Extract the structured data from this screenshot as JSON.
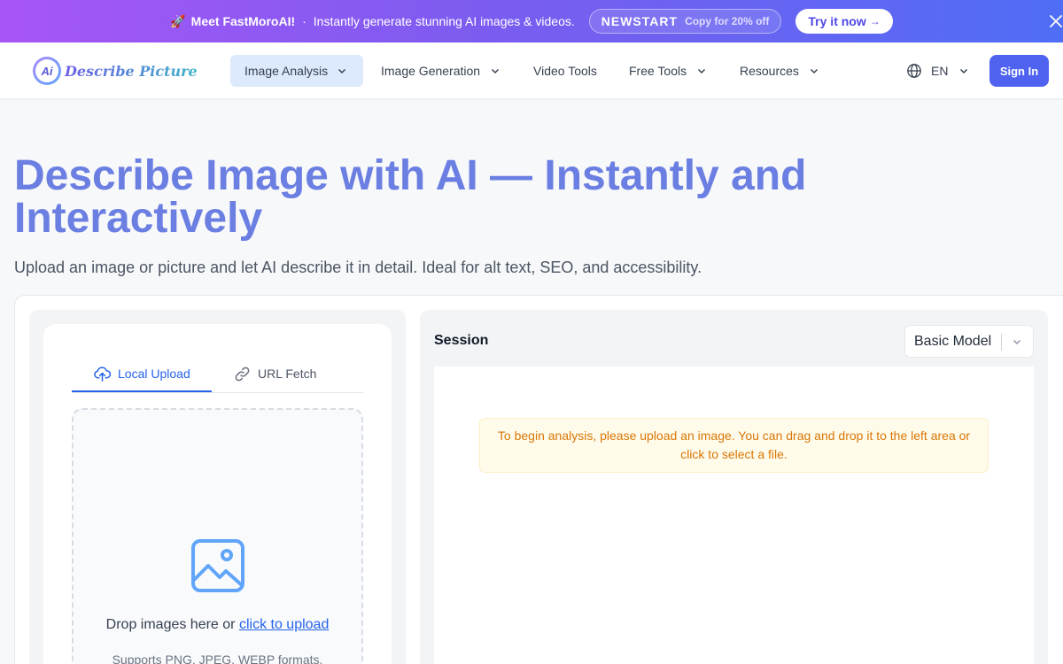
{
  "promo": {
    "rocket": "🚀",
    "headline": "Meet FastMoroAI!",
    "separator": "·",
    "text": "Instantly generate stunning AI images & videos.",
    "code": "NEWSTART",
    "copy_hint": "Copy for 20% off",
    "cta_label": "Try it now",
    "cta_arrow": "→"
  },
  "nav": {
    "logo_badge": "Ai",
    "logo_text": "Describe Picture",
    "items": [
      {
        "label": "Image Analysis",
        "active": true,
        "dropdown": true
      },
      {
        "label": "Image Generation",
        "active": false,
        "dropdown": true
      },
      {
        "label": "Video Tools",
        "active": false,
        "dropdown": false
      },
      {
        "label": "Free Tools",
        "active": false,
        "dropdown": true
      },
      {
        "label": "Resources",
        "active": false,
        "dropdown": true
      }
    ],
    "language": "EN",
    "signin_label": "Sign In"
  },
  "hero": {
    "title": "Describe Image with AI — Instantly and Interactively",
    "subtitle": "Upload an image or picture and let AI describe it in detail. Ideal for alt text, SEO, and accessibility."
  },
  "upload": {
    "tabs": [
      {
        "label": "Local Upload",
        "active": true
      },
      {
        "label": "URL Fetch",
        "active": false
      }
    ],
    "drop_text": "Drop images here or ",
    "drop_link": "click to upload",
    "formats": "Supports PNG, JPEG, WEBP formats."
  },
  "session": {
    "title": "Session",
    "model": "Basic Model",
    "notice": "To begin analysis, please upload an image. You can drag and drop it to the left area or click to select a file."
  },
  "colors": {
    "accent": "#4f63f0",
    "link": "#2563eb",
    "hero_title": "#6b7fe2",
    "notice_text": "#d97706",
    "notice_bg": "#fffbeb"
  }
}
